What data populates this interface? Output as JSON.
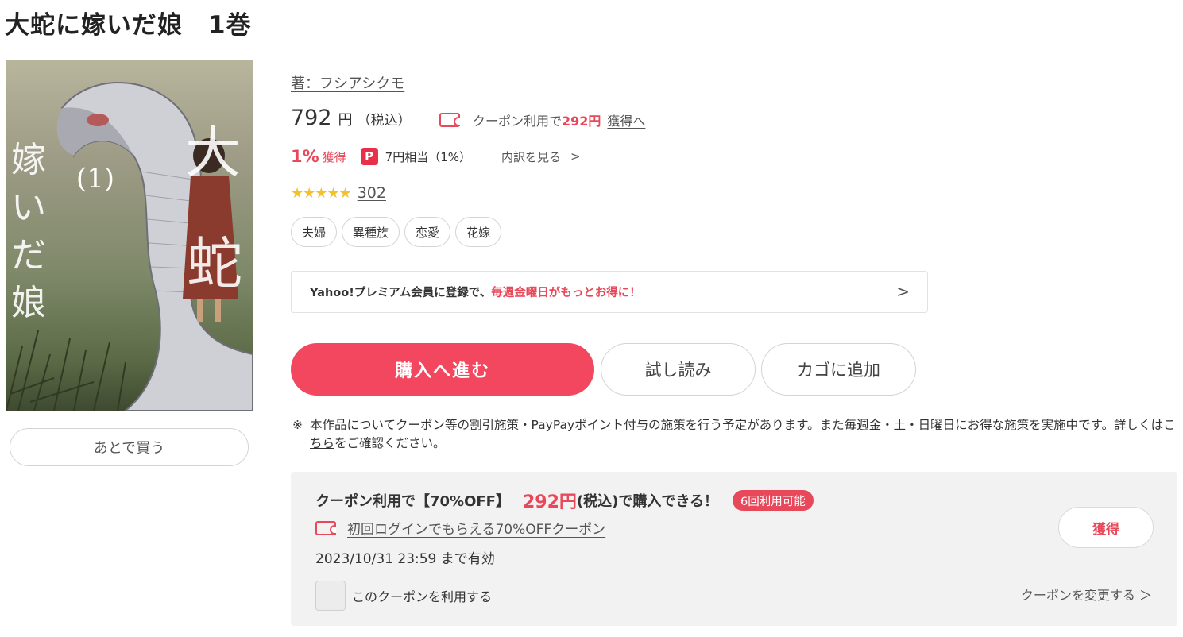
{
  "product": {
    "title": "大蛇に嫁いだ娘　1巻",
    "author": "著：フシアシクモ",
    "cover_alt": "大蛇に嫁いだ娘 1"
  },
  "price": {
    "value": "792",
    "unit": "円",
    "tax": "（税込）"
  },
  "coupon_summary": {
    "prefix": "クーポン利用で",
    "price": "292円",
    "get_link": "獲得へ"
  },
  "points": {
    "percent": "1%",
    "percent_label": "獲得",
    "paypay_icon": "P",
    "paypay_value": "7円相当（1%）",
    "breakdown": "内訳を見る",
    "chevron": ">"
  },
  "rating": {
    "stars": "★★★★★",
    "score": 4.5,
    "review_count": "302"
  },
  "tags": [
    "夫婦",
    "異種族",
    "恋愛",
    "花嫁"
  ],
  "premium_banner": {
    "text": "Yahoo!プレミアム会員に登録で、",
    "highlight": "毎週金曜日がもっとお得に！",
    "chevron": ">"
  },
  "actions": {
    "buy": "購入へ進む",
    "sample": "試し読み",
    "cart": "カゴに追加",
    "later": "あとで買う"
  },
  "notice": {
    "mark": "※",
    "text_before": "本作品についてクーポン等の割引施策・PayPayポイント付与の施策を行う予定があります。また毎週金・土・日曜日にお得な施策を実施中です。詳しくは",
    "link": "こちら",
    "text_after": "をご確認ください。"
  },
  "coupon_box": {
    "headline": "クーポン利用で【70%OFF】",
    "price": "292円",
    "price_suffix": "(税込)で購入できる！",
    "badge": "6回利用可能",
    "coupon_name": "初回ログインでもらえる70%OFFクーポン",
    "valid": "2023/10/31 23:59 まで有効",
    "checkbox_label": "このクーポンを利用する",
    "change": "クーポンを変更する ＞",
    "get_button": "獲得"
  },
  "colors": {
    "accent": "#e8495a",
    "buy_button": "#f2475e",
    "star": "#f3c12b",
    "coupon_bg": "#f2f2f2"
  }
}
